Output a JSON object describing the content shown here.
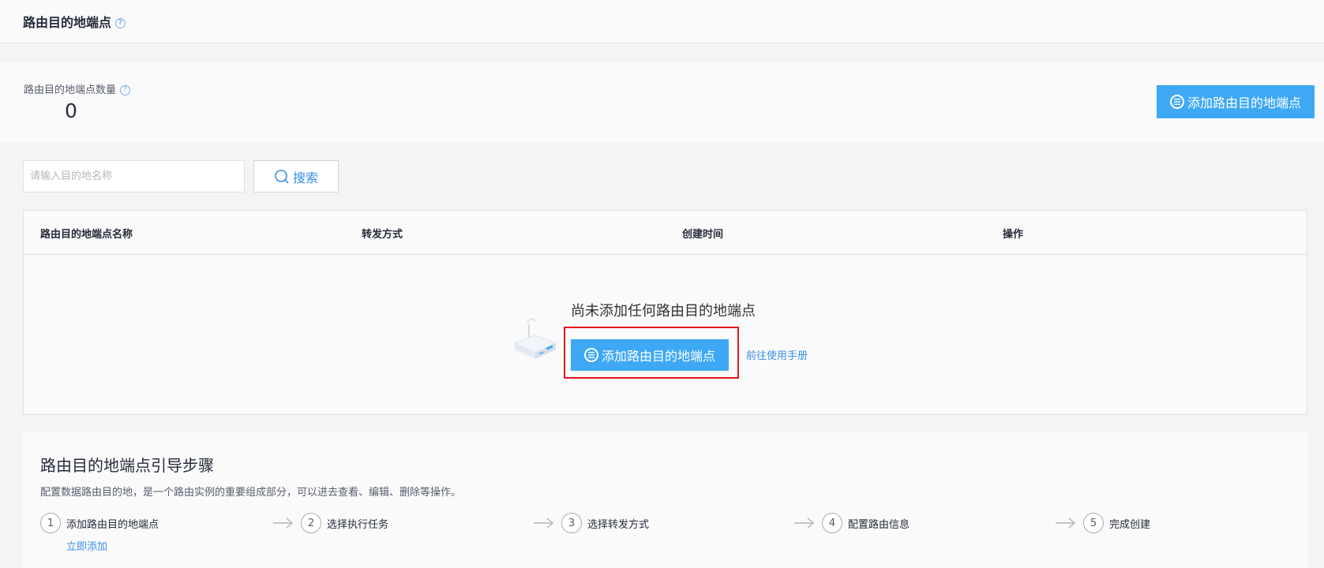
{
  "header": {
    "title": "路由目的地端点"
  },
  "summary": {
    "count_label": "路由目的地端点数量",
    "count_value": "0",
    "add_button_label": "添加路由目的地端点"
  },
  "search": {
    "placeholder": "请输入目的地名称",
    "button_label": "搜索"
  },
  "table": {
    "columns": [
      "路由目的地端点名称",
      "转发方式",
      "创建时间",
      "操作"
    ],
    "empty_text": "尚未添加任何路由目的地端点",
    "empty_add_label": "添加路由目的地端点",
    "manual_link": "前往使用手册"
  },
  "guide": {
    "title": "路由目的地端点引导步骤",
    "description": "配置数据路由目的地，是一个路由实例的重要组成部分，可以进去查看、编辑、删除等操作。",
    "steps": [
      {
        "num": "1",
        "label": "添加路由目的地端点"
      },
      {
        "num": "2",
        "label": "选择执行任务"
      },
      {
        "num": "3",
        "label": "选择转发方式"
      },
      {
        "num": "4",
        "label": "配置路由信息"
      },
      {
        "num": "5",
        "label": "完成创建"
      }
    ],
    "step_link": "立即添加"
  },
  "colors": {
    "primary": "#3ea8f5",
    "link": "#3a8ee6",
    "highlight": "#e5161e"
  }
}
